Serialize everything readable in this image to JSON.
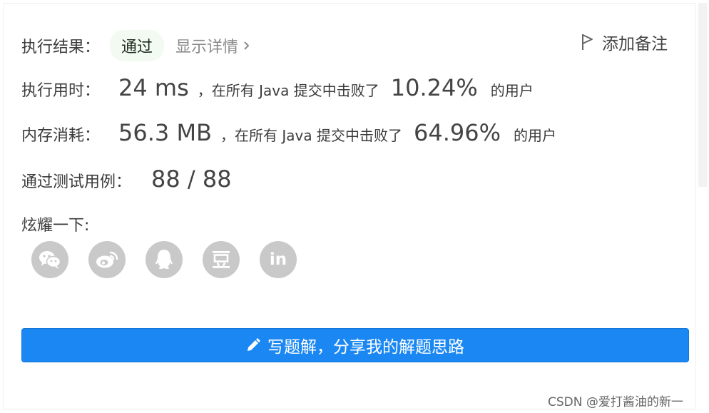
{
  "result": {
    "label": "执行结果：",
    "status": "通过",
    "detail_link": "显示详情",
    "note_button": "添加备注"
  },
  "runtime": {
    "label": "执行用时：",
    "value": "24 ms",
    "text_prefix": "，在所有 Java 提交中击败了",
    "percent": "10.24%",
    "text_suffix": "的用户"
  },
  "memory": {
    "label": "内存消耗：",
    "value": "56.3 MB",
    "text_prefix": "，在所有 Java 提交中击败了",
    "percent": "64.96%",
    "text_suffix": "的用户"
  },
  "tests": {
    "label": "通过测试用例：",
    "value": "88 / 88"
  },
  "share": {
    "label": "炫耀一下:",
    "icons": [
      "wechat-icon",
      "weibo-icon",
      "qq-icon",
      "douban-icon",
      "linkedin-icon"
    ],
    "linkedin_glyph": "in"
  },
  "write_solution_button": "写题解，分享我的解题思路",
  "watermark": "CSDN @爱打酱油的新一",
  "colors": {
    "primary": "#1b87f3",
    "success_bg": "#f2faf2",
    "icon_bg": "#c9c9c9"
  }
}
